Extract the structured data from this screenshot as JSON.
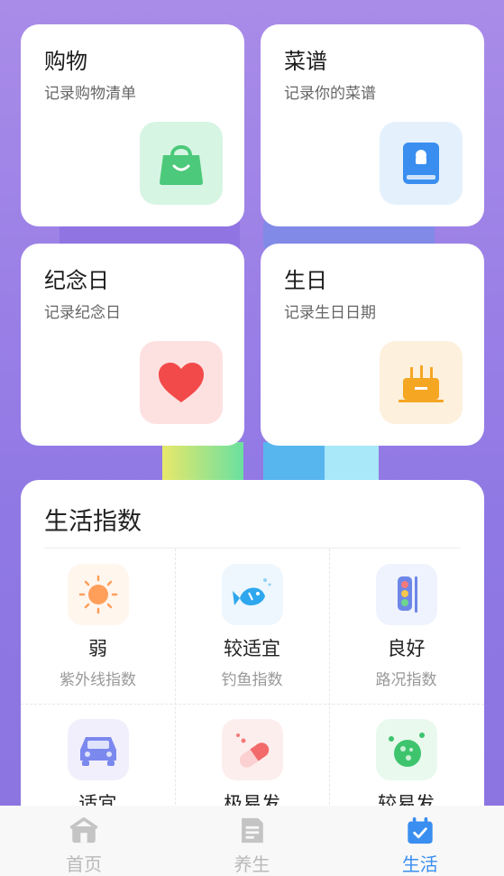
{
  "cards": [
    {
      "title": "购物",
      "subtitle": "记录购物清单",
      "icon": "shopping-bag-icon",
      "color": "#4cc97a",
      "bg": "#d6f5e3"
    },
    {
      "title": "菜谱",
      "subtitle": "记录你的菜谱",
      "icon": "recipe-book-icon",
      "color": "#3a8ef0",
      "bg": "#e4f1fd"
    },
    {
      "title": "纪念日",
      "subtitle": "记录纪念日",
      "icon": "heart-icon",
      "color": "#f24a4a",
      "bg": "#fde1e1"
    },
    {
      "title": "生日",
      "subtitle": "记录生日日期",
      "icon": "birthday-cake-icon",
      "color": "#f5a623",
      "bg": "#fdf0dc"
    }
  ],
  "life": {
    "title": "生活指数",
    "items": [
      {
        "value": "弱",
        "label": "紫外线指数",
        "icon": "sun-icon"
      },
      {
        "value": "较适宜",
        "label": "钓鱼指数",
        "icon": "fish-icon"
      },
      {
        "value": "良好",
        "label": "路况指数",
        "icon": "traffic-light-icon"
      },
      {
        "value": "适宜",
        "label": "",
        "icon": "car-icon"
      },
      {
        "value": "极易发",
        "label": "",
        "icon": "pill-icon"
      },
      {
        "value": "较易发",
        "label": "",
        "icon": "germ-icon"
      }
    ]
  },
  "tabs": [
    {
      "label": "首页",
      "icon": "home-icon",
      "active": false
    },
    {
      "label": "养生",
      "icon": "document-icon",
      "active": false
    },
    {
      "label": "生活",
      "icon": "calendar-check-icon",
      "active": true
    }
  ],
  "colors": {
    "accent": "#3a8ef0",
    "inactive": "#b9b9b9"
  }
}
